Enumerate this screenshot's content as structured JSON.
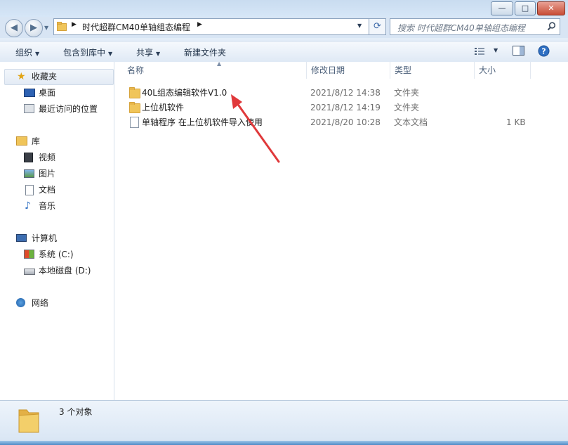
{
  "window": {
    "controls": {
      "minimize": "—",
      "maximize": "□",
      "close": "✕"
    }
  },
  "nav": {
    "back_icon": "back-arrow-icon",
    "forward_icon": "forward-arrow-icon",
    "breadcrumb": [
      "时代超群CM40单轴组态编程"
    ],
    "search_placeholder": "搜索 时代超群CM40单轴组态编程"
  },
  "toolbar": {
    "organize": "组织",
    "include_in_library": "包含到库中",
    "share": "共享",
    "new_folder": "新建文件夹"
  },
  "sidebar": {
    "favorites_label": "收藏夹",
    "favorites": [
      "桌面",
      "最近访问的位置"
    ],
    "libraries_label": "库",
    "libraries": [
      "视频",
      "图片",
      "文档",
      "音乐"
    ],
    "computer_label": "计算机",
    "drives": [
      "系统 (C:)",
      "本地磁盘 (D:)"
    ],
    "network_label": "网络"
  },
  "columns": {
    "name": "名称",
    "modified": "修改日期",
    "type": "类型",
    "size": "大小"
  },
  "files": [
    {
      "name": "40L组态编辑软件V1.0",
      "modified": "2021/8/12 14:38",
      "type": "文件夹",
      "size": "",
      "icon": "folder-icon"
    },
    {
      "name": "上位机软件",
      "modified": "2021/8/12 14:19",
      "type": "文件夹",
      "size": "",
      "icon": "folder-icon"
    },
    {
      "name": "单轴程序 在上位机软件导入使用",
      "modified": "2021/8/20 10:28",
      "type": "文本文档",
      "size": "1 KB",
      "icon": "text-document-icon"
    }
  ],
  "details": {
    "count_text": "3 个对象"
  },
  "colors": {
    "annotation_arrow": "#e0393b",
    "folder": "#f0c55a"
  }
}
